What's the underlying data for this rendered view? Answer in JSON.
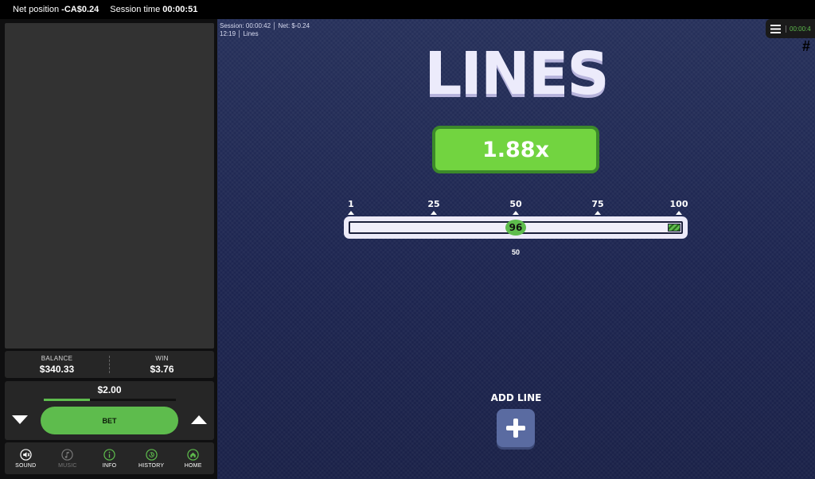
{
  "topbar": {
    "net_position_label": "Net position",
    "net_position_value": "-CA$0.24",
    "session_time_label": "Session time",
    "session_time_value": "00:00:51"
  },
  "stats": {
    "balance_label": "BALANCE",
    "balance_value": "$340.33",
    "win_label": "WIN",
    "win_value": "$3.76"
  },
  "bet": {
    "amount": "$2.00",
    "label": "BET",
    "level": 0.35
  },
  "toolbar": {
    "items": [
      {
        "label": "SOUND",
        "icon": "sound-muted-icon"
      },
      {
        "label": "MUSIC",
        "icon": "music-icon"
      },
      {
        "label": "INFO",
        "icon": "info-icon"
      },
      {
        "label": "HISTORY",
        "icon": "history-icon"
      },
      {
        "label": "HOME",
        "icon": "home-icon"
      }
    ]
  },
  "session_info": {
    "line1": "Session: 00:00:42 │ Net: $-0.24",
    "line2": "12:19 │ Lines"
  },
  "menu": {
    "timer": "00:00:4"
  },
  "hash_mark": "#",
  "game": {
    "title": "LINES",
    "multiplier": "1.88x",
    "ticks": [
      "1",
      "25",
      "50",
      "75",
      "100"
    ],
    "slider_value": "50",
    "thumb_label": "96",
    "add_line_label": "ADD LINE"
  },
  "colors": {
    "accent_green": "#5ebc4d",
    "game_bg": "#1d2550",
    "panel": "#262626"
  }
}
